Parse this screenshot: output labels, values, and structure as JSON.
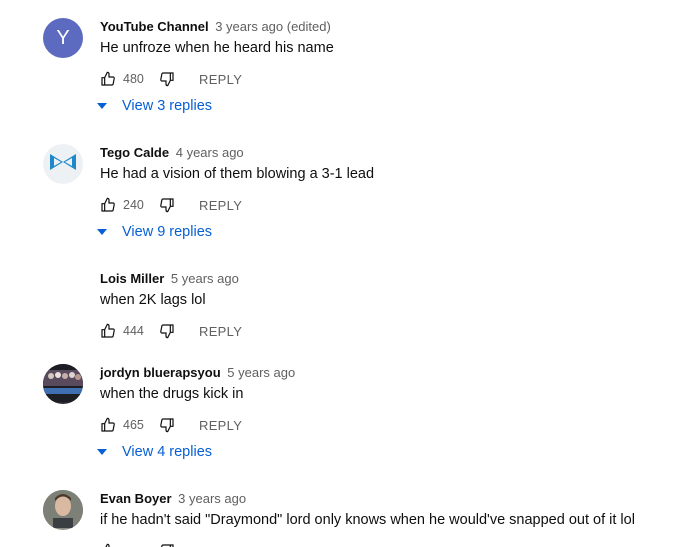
{
  "comments": [
    {
      "author": "YouTube Channel",
      "time": "3 years ago (edited)",
      "avatar_letter": "Y",
      "avatar_color": "#5c6bc0",
      "text": "He unfroze when he heard his name",
      "likes": "480",
      "reply_label": "REPLY",
      "view_replies": "View 3 replies"
    },
    {
      "author": "Tego Calde",
      "time": "4 years ago",
      "avatar_icon": "bowtie-logo-icon",
      "text": "He had a vision of them blowing a 3-1 lead",
      "likes": "240",
      "reply_label": "REPLY",
      "view_replies": "View 9 replies"
    },
    {
      "author": "Lois Miller",
      "time": "5 years ago",
      "text": "when 2K lags lol",
      "likes": "444",
      "reply_label": "REPLY"
    },
    {
      "author": "jordyn bluerapsyou",
      "time": "5 years ago",
      "avatar_icon": "crowd-photo-avatar",
      "text": "when the drugs kick in",
      "likes": "465",
      "reply_label": "REPLY",
      "view_replies": "View 4 replies"
    },
    {
      "author": "Evan Boyer",
      "time": "3 years ago",
      "avatar_icon": "face-photo-avatar",
      "text": "if he hadn't said \"Draymond\" lord only knows when he would've snapped out of it lol"
    }
  ],
  "colors": {
    "link": "#065fd4",
    "muted": "#606060"
  }
}
